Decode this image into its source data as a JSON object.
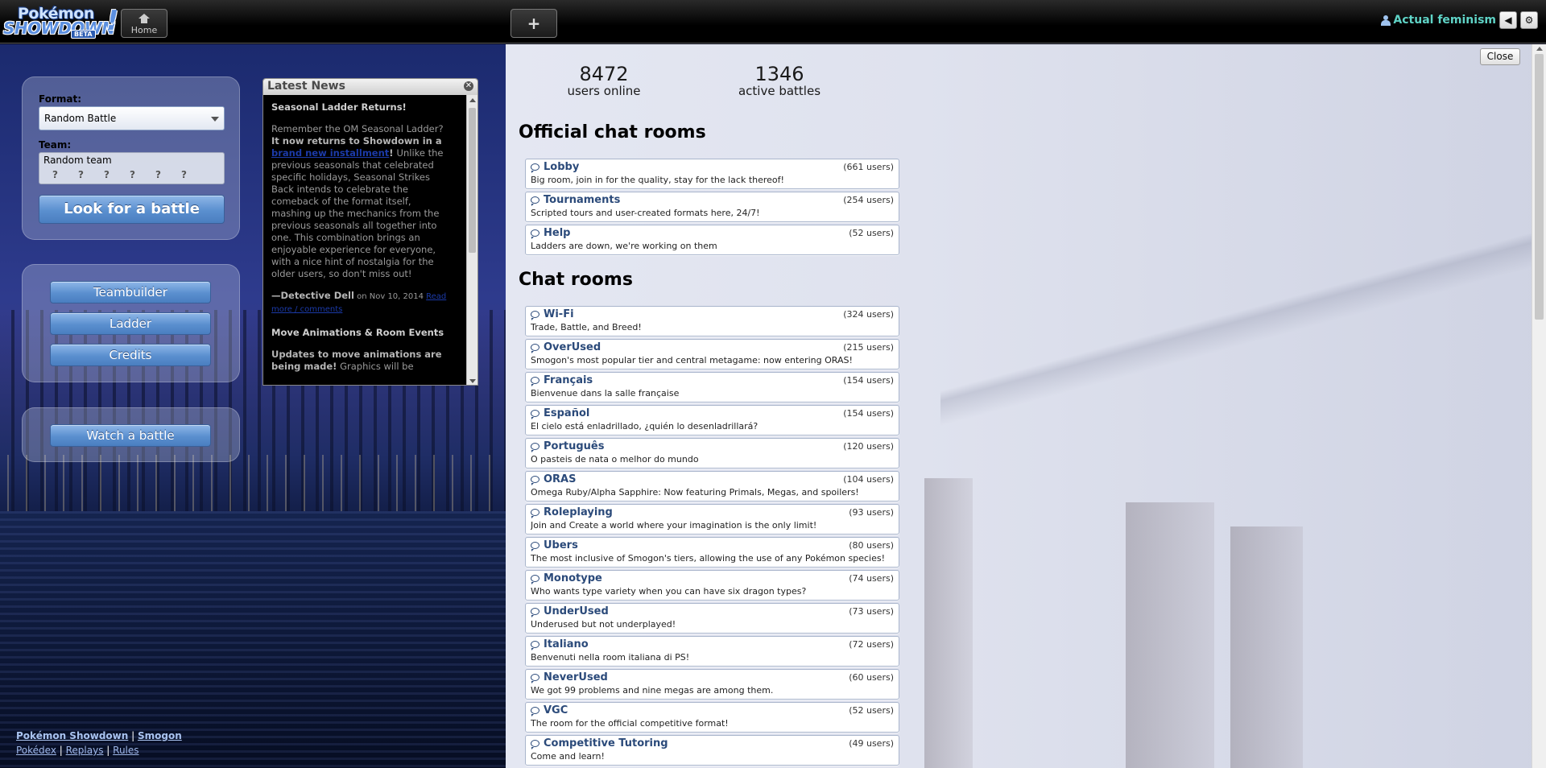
{
  "topbar": {
    "logo": {
      "line1": "Pokémon",
      "line2": "SHOWDOWN",
      "badge": "BETA",
      "mark": "!"
    },
    "home_tab_label": "Home",
    "new_tab_label": "+",
    "username": "Actual feminism",
    "sound_icon": "speaker-icon",
    "settings_icon": "gear-icon"
  },
  "menu": {
    "format_label": "Format:",
    "format_value": "Random Battle",
    "team_label": "Team:",
    "team_value": "Random team",
    "look_button": "Look for a battle",
    "teambuilder_button": "Teambuilder",
    "ladder_button": "Ladder",
    "credits_button": "Credits",
    "watch_button": "Watch a battle"
  },
  "news": {
    "title": "Latest News",
    "article1_title": "Seasonal Ladder Returns!",
    "p1_a": "Remember the OM Seasonal Ladder? ",
    "p1_b": "It now returns to Showdown in a ",
    "p1_link": "brand new installment",
    "p1_c": "! ",
    "p1_d": "Unlike the previous seasonals that celebrated specific holidays, Seasonal Strikes Back intends to celebrate the comeback of the format itself, mashing up the mechanics from the previous seasonals all together into one. This combination brings an enjoyable experience for everyone, with a nice hint of nostalgia for the older users, so don't miss out!",
    "author": "—Detective Dell",
    "date": " on Nov 10, 2014 ",
    "comments_link": "Read more / comments",
    "article2_title": "Move Animations & Room Events",
    "p2_b": "Updates to move animations are being made!",
    "p2_c": " Graphics will be"
  },
  "footer": {
    "showdown_link": "Pokémon Showdown",
    "smogon_link": "Smogon",
    "sep": " | ",
    "pokedex_link": "Pokédex",
    "replays_link": "Replays",
    "rules_link": "Rules"
  },
  "stats": {
    "users_count": "8472",
    "users_label": "users online",
    "battles_count": "1346",
    "battles_label": "active battles"
  },
  "official_title": "Official chat rooms",
  "official_rooms": [
    {
      "name": "Lobby",
      "users": "(661 users)",
      "desc": "Big room, join in for the quality, stay for the lack thereof!"
    },
    {
      "name": "Tournaments",
      "users": "(254 users)",
      "desc": "Scripted tours and user-created formats here, 24/7!"
    },
    {
      "name": "Help",
      "users": "(52 users)",
      "desc": "Ladders are down, we're working on them"
    }
  ],
  "chat_title": "Chat rooms",
  "chat_rooms": [
    {
      "name": "Wi-Fi",
      "users": "(324 users)",
      "desc": "Trade, Battle, and Breed!"
    },
    {
      "name": "OverUsed",
      "users": "(215 users)",
      "desc": "Smogon's most popular tier and central metagame: now entering ORAS!"
    },
    {
      "name": "Français",
      "users": "(154 users)",
      "desc": "Bienvenue dans la salle française"
    },
    {
      "name": "Español",
      "users": "(154 users)",
      "desc": "El cielo está enladrillado, ¿quién lo desenladrillará?"
    },
    {
      "name": "Português",
      "users": "(120 users)",
      "desc": "O pasteis de nata o melhor do mundo"
    },
    {
      "name": "ORAS",
      "users": "(104 users)",
      "desc": "Omega Ruby/Alpha Sapphire: Now featuring Primals, Megas, and spoilers!"
    },
    {
      "name": "Roleplaying",
      "users": "(93 users)",
      "desc": "Join and Create a world where your imagination is the only limit!"
    },
    {
      "name": "Ubers",
      "users": "(80 users)",
      "desc": "The most inclusive of Smogon's tiers, allowing the use of any Pokémon species!"
    },
    {
      "name": "Monotype",
      "users": "(74 users)",
      "desc": "Who wants type variety when you can have six dragon types?"
    },
    {
      "name": "UnderUsed",
      "users": "(73 users)",
      "desc": "Underused but not underplayed!"
    },
    {
      "name": "Italiano",
      "users": "(72 users)",
      "desc": "Benvenuti nella room italiana di PS!"
    },
    {
      "name": "NeverUsed",
      "users": "(60 users)",
      "desc": "We got 99 problems and nine megas are among them."
    },
    {
      "name": "VGC",
      "users": "(52 users)",
      "desc": "The room for the official competitive format!"
    },
    {
      "name": "Competitive Tutoring",
      "users": "(49 users)",
      "desc": "Come and learn!"
    }
  ],
  "close_button": "Close"
}
